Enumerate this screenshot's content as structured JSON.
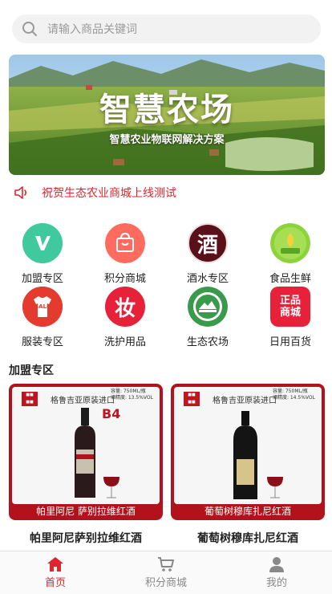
{
  "search": {
    "placeholder": "请输入商品关键词"
  },
  "banner": {
    "title": "智慧农场",
    "subtitle": "智慧农业物联网解决方案"
  },
  "notice": {
    "text": "祝贺生态农业商城上线测试"
  },
  "categories": [
    {
      "label": "加盟专区",
      "icon": "join-zone-icon"
    },
    {
      "label": "积分商城",
      "icon": "points-shop-icon"
    },
    {
      "label": "酒水专区",
      "icon": "liquor-icon",
      "glyph": "酒"
    },
    {
      "label": "食品生鲜",
      "icon": "fresh-food-icon"
    },
    {
      "label": "服装专区",
      "icon": "clothing-sale-icon",
      "glyph": "SALE"
    },
    {
      "label": "洗护用品",
      "icon": "toiletries-icon",
      "glyph": "妆"
    },
    {
      "label": "生态农场",
      "icon": "eco-farm-icon"
    },
    {
      "label": "日用百货",
      "icon": "daily-goods-icon",
      "glyph": "正品商城"
    }
  ],
  "section": {
    "title": "加盟专区"
  },
  "products": [
    {
      "name": "帕里阿尼萨别拉维红酒",
      "image_caption": "帕里阿尼  萨别拉维红酒",
      "importer": "格鲁吉亚原装进口",
      "spec_volume": "容量: 750ML/瓶",
      "spec_abv": "酒精度: 13.5%VOL",
      "badge": "B4"
    },
    {
      "name": "葡萄树穆库扎尼红酒",
      "image_caption": "葡萄树穆库扎尼红酒",
      "importer": "格鲁吉亚原装进口",
      "spec_volume": "容量: 750ML/瓶",
      "spec_abv": "酒精度: 14.5%VOL",
      "badge": ""
    }
  ],
  "tabs": [
    {
      "label": "首页",
      "active": true
    },
    {
      "label": "积分商城",
      "active": false
    },
    {
      "label": "我的",
      "active": false
    }
  ],
  "colors": {
    "accent": "#e0262d",
    "wine_frame": "#b2121c"
  }
}
